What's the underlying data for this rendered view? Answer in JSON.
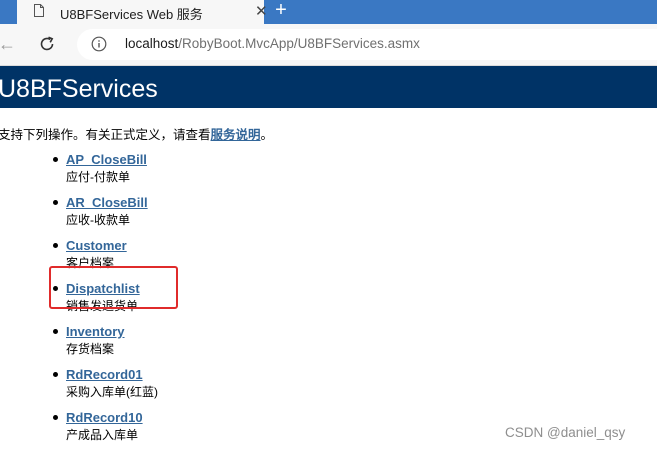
{
  "tab": {
    "title": "U8BFServices Web 服务",
    "close_glyph": "✕",
    "new_tab_glyph": "+"
  },
  "toolbar": {
    "back_glyph": "←",
    "url_host": "localhost",
    "url_path": "/RobyBoot.MvcApp/U8BFServices.asmx"
  },
  "page": {
    "title": "U8BFServices",
    "intro_before": "支持下列操作。有关正式定义，请查看",
    "intro_link": "服务说明",
    "intro_after": "。"
  },
  "operations": [
    {
      "name": "AP_CloseBill",
      "desc": "应付-付款单"
    },
    {
      "name": "AR_CloseBill",
      "desc": "应收-收款单"
    },
    {
      "name": "Customer",
      "desc": "客户档案"
    },
    {
      "name": "Dispatchlist",
      "desc": "销售发退货单"
    },
    {
      "name": "Inventory",
      "desc": "存货档案"
    },
    {
      "name": "RdRecord01",
      "desc": "采购入库单(红蓝)"
    },
    {
      "name": "RdRecord10",
      "desc": "产成品入库单"
    }
  ],
  "watermark": "CSDN @daniel_qsy",
  "colors": {
    "tab_strip": "#3a78c3",
    "header_bg": "#003366",
    "link": "#336699",
    "highlight": "#e02b2b"
  }
}
